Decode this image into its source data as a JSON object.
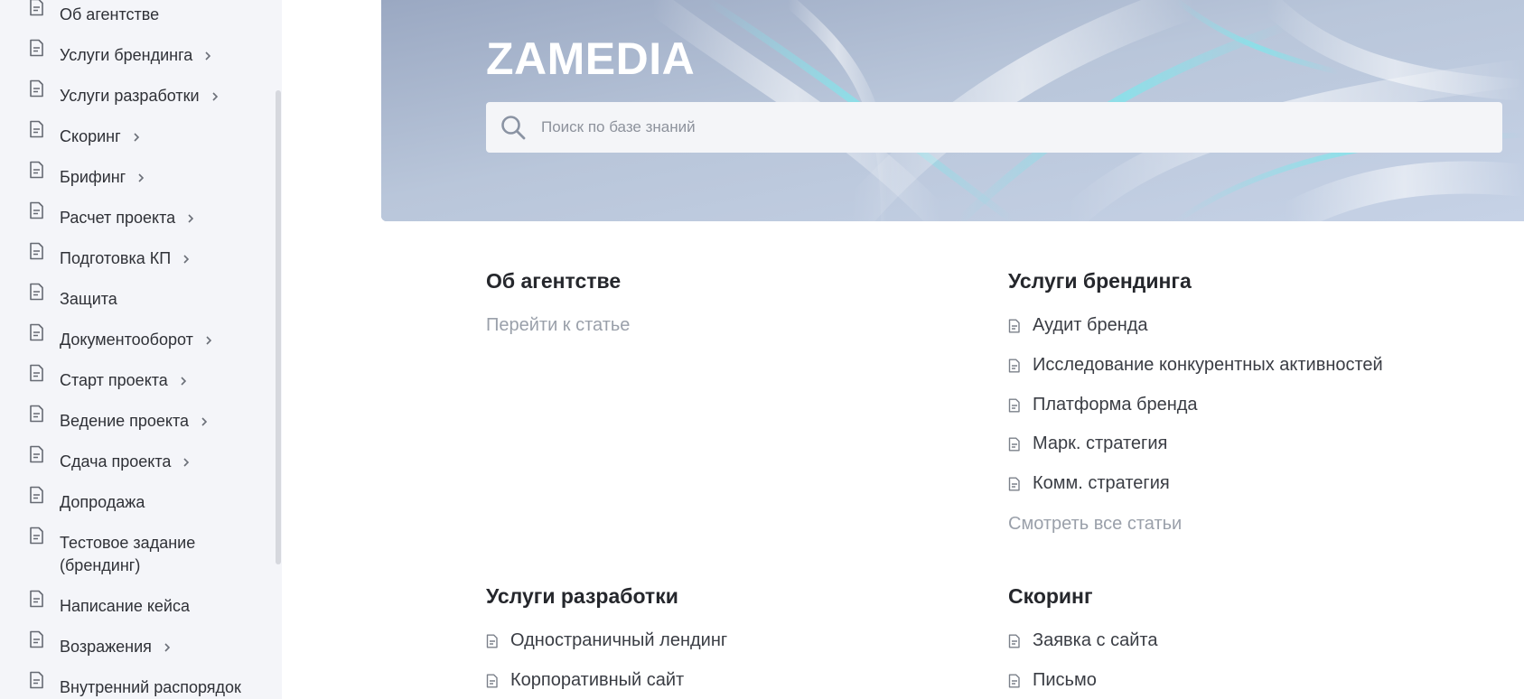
{
  "sidebar": {
    "items": [
      {
        "label": "Об агентстве",
        "has_children": false
      },
      {
        "label": "Услуги брендинга",
        "has_children": true
      },
      {
        "label": "Услуги разработки",
        "has_children": true
      },
      {
        "label": "Скоринг",
        "has_children": true
      },
      {
        "label": "Брифинг",
        "has_children": true
      },
      {
        "label": "Расчет проекта",
        "has_children": true
      },
      {
        "label": "Подготовка КП",
        "has_children": true
      },
      {
        "label": "Защита",
        "has_children": false
      },
      {
        "label": "Документооборот",
        "has_children": true
      },
      {
        "label": "Старт проекта",
        "has_children": true
      },
      {
        "label": "Ведение проекта",
        "has_children": true
      },
      {
        "label": "Сдача проекта",
        "has_children": true
      },
      {
        "label": "Допродажа",
        "has_children": false
      },
      {
        "label_line1": "Тестовое задание",
        "label_line2": "(брендинг)",
        "has_children": false
      },
      {
        "label": "Написание кейса",
        "has_children": false
      },
      {
        "label": "Возражения",
        "has_children": true
      },
      {
        "label": "Внутренний распорядок",
        "has_children": false
      }
    ]
  },
  "hero": {
    "brand": "ZAMEDIA",
    "search_placeholder": "Поиск по базе знаний"
  },
  "sections": {
    "about": {
      "title": "Об агентстве",
      "link": "Перейти к статье"
    },
    "branding": {
      "title": "Услуги брендинга",
      "articles": [
        "Аудит бренда",
        "Исследование конкурентных активностей",
        "Платформа бренда",
        "Марк. стратегия",
        "Комм. стратегия"
      ],
      "see_all": "Смотреть все статьи"
    },
    "development": {
      "title": "Услуги разработки",
      "articles": [
        "Одностраничный лендинг",
        "Корпоративный сайт"
      ]
    },
    "scoring": {
      "title": "Скоринг",
      "articles": [
        "Заявка с сайта",
        "Письмо"
      ]
    }
  },
  "colors": {
    "sidebar_bg": "#f4f5f9",
    "text_dark": "#2b2d33",
    "text_muted": "#9aa0aa",
    "search_bg": "#f4f5f8",
    "hero_base": "#a7b4cb"
  },
  "icons": {
    "article": "document-icon",
    "expand": "chevron-right-icon",
    "search": "search-icon"
  }
}
